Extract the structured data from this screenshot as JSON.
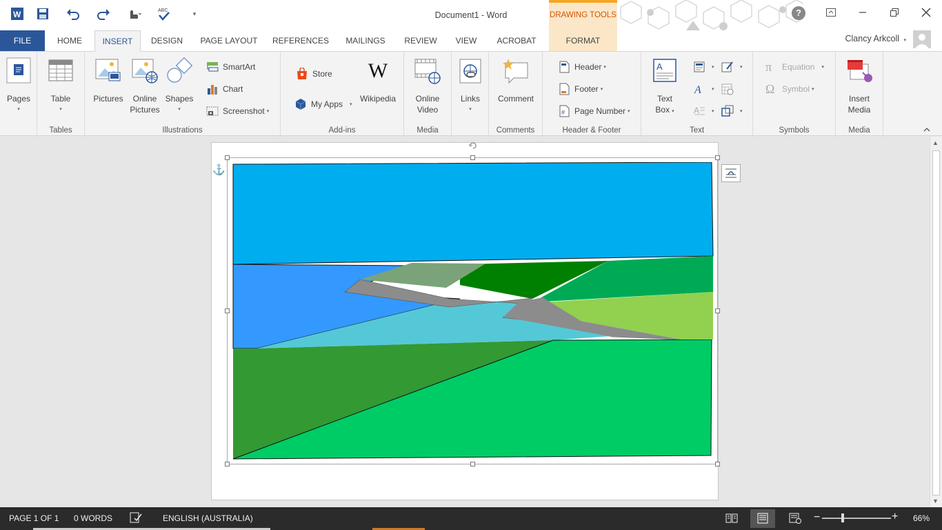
{
  "window": {
    "title": "Document1 - Word",
    "drawing_tools_label": "DRAWING TOOLS",
    "user_name": "Clancy Arkcoll"
  },
  "tabs": {
    "file": "FILE",
    "home": "HOME",
    "insert": "INSERT",
    "design": "DESIGN",
    "page_layout": "PAGE LAYOUT",
    "references": "REFERENCES",
    "mailings": "MAILINGS",
    "review": "REVIEW",
    "view": "VIEW",
    "acrobat": "ACROBAT",
    "format": "FORMAT",
    "active": "INSERT"
  },
  "ribbon": {
    "pages": {
      "label": "Pages"
    },
    "tables": {
      "table": "Table",
      "group": "Tables"
    },
    "illustrations": {
      "pictures": "Pictures",
      "online_pictures_1": "Online",
      "online_pictures_2": "Pictures",
      "shapes": "Shapes",
      "smartart": "SmartArt",
      "chart": "Chart",
      "screenshot": "Screenshot",
      "group": "Illustrations"
    },
    "addins": {
      "store": "Store",
      "my_apps": "My Apps",
      "wikipedia": "Wikipedia",
      "group": "Add-ins"
    },
    "media": {
      "online_video_1": "Online",
      "online_video_2": "Video",
      "group": "Media"
    },
    "links": {
      "links": "Links"
    },
    "comments": {
      "comment": "Comment",
      "group": "Comments"
    },
    "header_footer": {
      "header": "Header",
      "footer": "Footer",
      "page_number": "Page Number",
      "group": "Header & Footer"
    },
    "text": {
      "text_box_1": "Text",
      "text_box_2": "Box",
      "group": "Text"
    },
    "symbols": {
      "equation": "Equation",
      "symbol": "Symbol",
      "group": "Symbols"
    },
    "media2": {
      "insert_media_1": "Insert",
      "insert_media_2": "Media",
      "group": "Media"
    }
  },
  "statusbar": {
    "page": "PAGE 1 OF 1",
    "words": "0 WORDS",
    "language": "ENGLISH (AUSTRALIA)",
    "zoom": "66%",
    "zoom_percent": 66
  },
  "colors": {
    "word_blue": "#2b579a",
    "drawing_tools_orange": "#d35400",
    "sky": "#00adef",
    "water": "#3399ff",
    "water_light": "#55c8d8",
    "green_dark": "#339933",
    "green_bright": "#00cc66",
    "green_mid": "#00aa55",
    "green_forest": "#008000",
    "green_lime": "#92d050",
    "rock_grey": "#8c8c8c",
    "rock_sage": "#7aa37a"
  }
}
